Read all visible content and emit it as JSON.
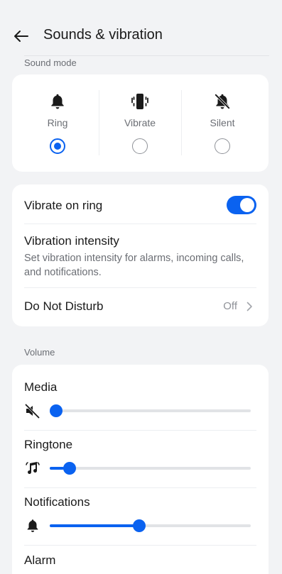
{
  "header": {
    "title": "Sounds & vibration"
  },
  "sound_mode": {
    "section_label": "Sound mode",
    "options": [
      {
        "label": "Ring",
        "icon": "bell-icon",
        "selected": true
      },
      {
        "label": "Vibrate",
        "icon": "vibrate-icon",
        "selected": false
      },
      {
        "label": "Silent",
        "icon": "bell-off-icon",
        "selected": false
      }
    ]
  },
  "settings": {
    "vibrate_on_ring": {
      "label": "Vibrate on ring",
      "enabled": true
    },
    "vibration_intensity": {
      "label": "Vibration intensity",
      "description": "Set vibration intensity for alarms, incoming calls, and notifications."
    },
    "do_not_disturb": {
      "label": "Do Not Disturb",
      "value": "Off"
    }
  },
  "volume": {
    "section_label": "Volume",
    "items": [
      {
        "label": "Media",
        "icon": "volume-mute-icon",
        "level": 0.0
      },
      {
        "label": "Ringtone",
        "icon": "music-note-icon",
        "level": 0.07
      },
      {
        "label": "Notifications",
        "icon": "bell-icon",
        "level": 0.44
      },
      {
        "label": "Alarm",
        "icon": "alarm-icon"
      }
    ]
  },
  "colors": {
    "accent": "#0a62f0",
    "background": "#f2f3f5",
    "card": "#ffffff"
  }
}
